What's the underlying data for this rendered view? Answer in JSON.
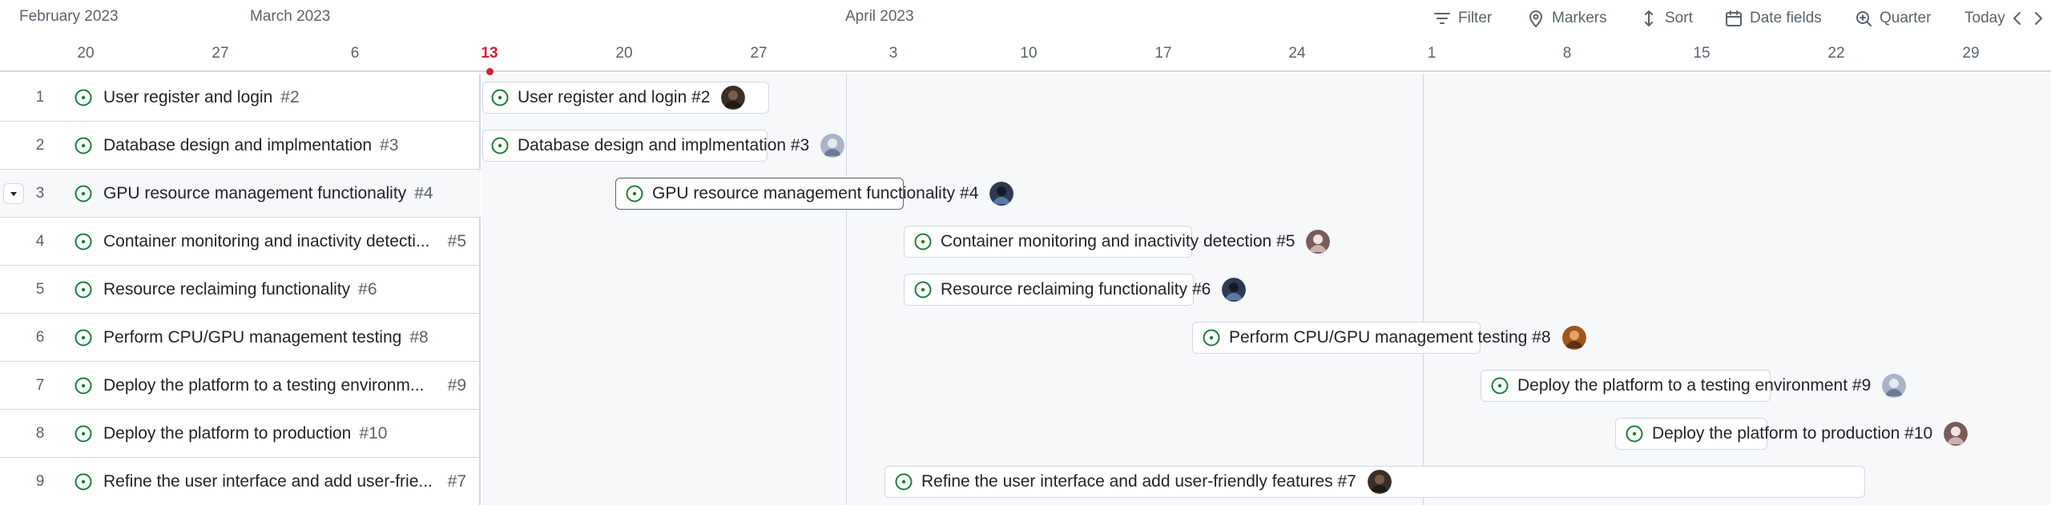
{
  "header": {
    "months": [
      "February 2023",
      "March 2023",
      "April 2023"
    ],
    "days": [
      "20",
      "27",
      "6",
      "13",
      "20",
      "27",
      "3",
      "10",
      "17",
      "24",
      "1",
      "8",
      "15",
      "22",
      "29"
    ],
    "today_day": "13"
  },
  "toolbar": {
    "filter_label": "Filter",
    "markers_label": "Markers",
    "sort_label": "Sort",
    "date_fields_label": "Date fields",
    "zoom_label": "Quarter",
    "today_label": "Today"
  },
  "rows": [
    {
      "num": "1",
      "title": "User register and login",
      "ref": "#2"
    },
    {
      "num": "2",
      "title": "Database design and implmentation",
      "ref": "#3"
    },
    {
      "num": "3",
      "title": "GPU resource management functionality",
      "ref": "#4"
    },
    {
      "num": "4",
      "title": "Container monitoring and inactivity detecti...",
      "ref": "#5"
    },
    {
      "num": "5",
      "title": "Resource reclaiming functionality",
      "ref": "#6"
    },
    {
      "num": "6",
      "title": "Perform CPU/GPU management testing",
      "ref": "#8"
    },
    {
      "num": "7",
      "title": "Deploy the platform to a testing environm...",
      "ref": "#9"
    },
    {
      "num": "8",
      "title": "Deploy the platform to production",
      "ref": "#10"
    },
    {
      "num": "9",
      "title": "Refine the user interface and add user-frie...",
      "ref": "#7"
    }
  ],
  "bars": [
    {
      "label": "User register and login #2",
      "avatar": "avatar-dark"
    },
    {
      "label": "Database design and implmentation #3",
      "avatar": "avatar-bluegray"
    },
    {
      "label": "GPU resource management functionality #4",
      "avatar": "avatar-navy"
    },
    {
      "label": "Container monitoring and inactivity detection #5",
      "avatar": "avatar-brown"
    },
    {
      "label": "Resource reclaiming functionality #6",
      "avatar": "avatar-navy"
    },
    {
      "label": "Perform CPU/GPU management testing #8",
      "avatar": "avatar-orange"
    },
    {
      "label": "Deploy the platform to a testing environment #9",
      "avatar": "avatar-bluegray"
    },
    {
      "label": "Deploy the platform to production #10",
      "avatar": "avatar-brown"
    },
    {
      "label": "Refine the user interface and add user-friendly features #7",
      "avatar": "avatar-dark"
    }
  ],
  "colors": {
    "open_issue": "#1a7f37",
    "today_marker": "#cf222e",
    "border": "#d1d9e0",
    "muted_text": "#59636e"
  },
  "icons": {
    "filter": "filter-icon",
    "markers": "map-pin-icon",
    "sort": "sort-icon",
    "date_fields": "calendar-icon",
    "zoom": "zoom-in-icon",
    "prev": "chevron-left-icon",
    "next": "chevron-right-icon",
    "issue": "issue-opened-icon"
  }
}
